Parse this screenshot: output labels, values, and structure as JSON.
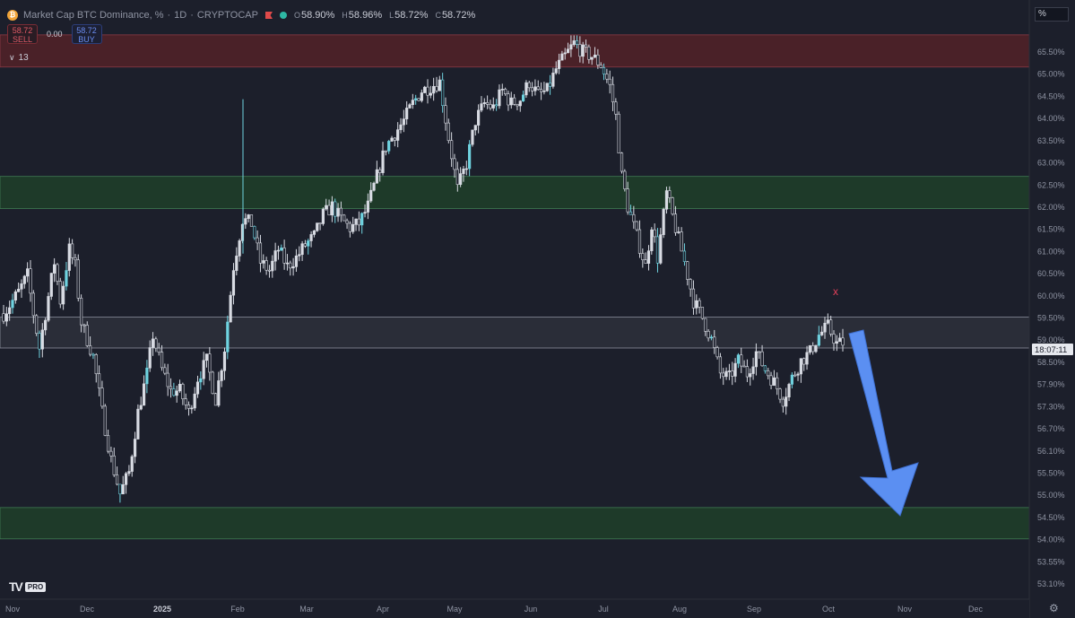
{
  "header": {
    "coin_symbol": "₿",
    "title": "Market Cap BTC Dominance, %",
    "interval": "1D",
    "source": "CRYPTOCAP",
    "ohlc": [
      {
        "label": "O",
        "value": "58.90%"
      },
      {
        "label": "H",
        "value": "58.96%"
      },
      {
        "label": "L",
        "value": "58.72%"
      },
      {
        "label": "C",
        "value": "58.72%"
      }
    ]
  },
  "trade": {
    "sell_price": "58.72",
    "sell_label": "SELL",
    "spread": "0.00",
    "buy_price": "58.72",
    "buy_label": "BUY"
  },
  "indicators_count": "13",
  "scale_mode": "%",
  "countdown": "18:07:11",
  "logo_badge": "PRO",
  "colors": {
    "background": "#1c1f2b",
    "candle": "#d8dbe3",
    "candle_accent": "#6fd3e0",
    "resistance_zone": "#4a2128",
    "support_zone": "#1e3a29",
    "pivot_zone": "#2a2d38",
    "arrow": "#5b8ff2",
    "marker": "#e0405a"
  },
  "chart_data": {
    "type": "candlestick",
    "y_axis": {
      "range": [
        52.8,
        66.1
      ],
      "tick_labels": [
        "65.50%",
        "65.00%",
        "64.50%",
        "64.00%",
        "63.50%",
        "63.00%",
        "62.50%",
        "62.00%",
        "61.50%",
        "61.00%",
        "60.50%",
        "60.00%",
        "59.50%",
        "59.00%",
        "58.50%",
        "57.90%",
        "57.30%",
        "56.70%",
        "56.10%",
        "55.50%",
        "55.00%",
        "54.50%",
        "54.00%",
        "53.55%",
        "53.10%"
      ]
    },
    "x_axis": {
      "tick_labels": [
        "Nov",
        "Dec",
        "2025",
        "Feb",
        "Mar",
        "Apr",
        "May",
        "Jun",
        "Jul",
        "Aug",
        "Sep",
        "Oct",
        "Nov",
        "Dec"
      ]
    },
    "last_price": "58.72",
    "zones": [
      {
        "kind": "resistance",
        "from": 65.15,
        "to": 65.9
      },
      {
        "kind": "support",
        "from": 61.85,
        "to": 62.6
      },
      {
        "kind": "pivot",
        "from": 58.6,
        "to": 59.32
      },
      {
        "kind": "support",
        "from": 54.15,
        "to": 54.88
      }
    ],
    "path_points": [
      [
        0,
        59.4
      ],
      [
        5,
        59.9
      ],
      [
        8,
        60.3
      ],
      [
        10,
        59.4
      ],
      [
        12,
        58.6
      ],
      [
        15,
        59.8
      ],
      [
        17,
        60.6
      ],
      [
        19,
        59.7
      ],
      [
        22,
        60.9
      ],
      [
        24,
        60.5
      ],
      [
        26,
        59.2
      ],
      [
        30,
        58.4
      ],
      [
        33,
        57.1
      ],
      [
        36,
        56.0
      ],
      [
        39,
        55.2
      ],
      [
        42,
        55.7
      ],
      [
        45,
        57.1
      ],
      [
        48,
        58.0
      ],
      [
        50,
        58.9
      ],
      [
        53,
        58.1
      ],
      [
        56,
        57.6
      ],
      [
        59,
        57.6
      ],
      [
        62,
        57.1
      ],
      [
        65,
        57.9
      ],
      [
        68,
        58.3
      ],
      [
        71,
        57.4
      ],
      [
        74,
        58.6
      ],
      [
        77,
        60.5
      ],
      [
        80,
        61.6
      ],
      [
        83,
        61.5
      ],
      [
        86,
        60.6
      ],
      [
        89,
        60.4
      ],
      [
        92,
        60.9
      ],
      [
        95,
        60.5
      ],
      [
        98,
        60.7
      ],
      [
        101,
        61.0
      ],
      [
        104,
        61.2
      ],
      [
        107,
        61.7
      ],
      [
        110,
        61.9
      ],
      [
        113,
        61.6
      ],
      [
        116,
        61.4
      ],
      [
        119,
        61.5
      ],
      [
        122,
        61.9
      ],
      [
        125,
        62.6
      ],
      [
        128,
        63.3
      ],
      [
        131,
        63.6
      ],
      [
        134,
        63.9
      ],
      [
        137,
        64.3
      ],
      [
        140,
        64.6
      ],
      [
        143,
        64.7
      ],
      [
        146,
        64.8
      ],
      [
        149,
        63.5
      ],
      [
        152,
        62.3
      ],
      [
        155,
        62.9
      ],
      [
        158,
        63.9
      ],
      [
        161,
        64.3
      ],
      [
        164,
        64.2
      ],
      [
        167,
        64.6
      ],
      [
        170,
        64.3
      ],
      [
        173,
        64.4
      ],
      [
        176,
        64.8
      ],
      [
        179,
        64.5
      ],
      [
        182,
        64.6
      ],
      [
        185,
        65.1
      ],
      [
        188,
        65.4
      ],
      [
        191,
        65.7
      ],
      [
        194,
        65.5
      ],
      [
        197,
        65.4
      ],
      [
        200,
        65.2
      ],
      [
        203,
        64.7
      ],
      [
        205,
        64.0
      ],
      [
        207,
        62.6
      ],
      [
        209,
        61.9
      ],
      [
        212,
        61.2
      ],
      [
        215,
        60.5
      ],
      [
        217,
        61.5
      ],
      [
        219,
        60.7
      ],
      [
        222,
        62.2
      ],
      [
        225,
        61.4
      ],
      [
        228,
        60.6
      ],
      [
        231,
        59.7
      ],
      [
        234,
        59.3
      ],
      [
        237,
        58.8
      ],
      [
        240,
        58.0
      ],
      [
        243,
        57.9
      ],
      [
        246,
        58.3
      ],
      [
        249,
        58.0
      ],
      [
        252,
        58.5
      ],
      [
        255,
        58.1
      ],
      [
        258,
        57.8
      ],
      [
        261,
        57.4
      ],
      [
        264,
        57.9
      ],
      [
        267,
        58.3
      ],
      [
        270,
        58.5
      ],
      [
        273,
        58.9
      ],
      [
        276,
        59.1
      ],
      [
        279,
        58.7
      ],
      [
        281,
        58.72
      ]
    ]
  }
}
